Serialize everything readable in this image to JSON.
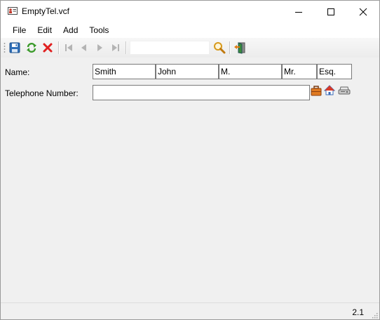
{
  "window": {
    "title": "EmptyTel.vcf",
    "icon": "vcard-icon"
  },
  "titlebar_buttons": {
    "minimize": "minimize-icon",
    "maximize": "maximize-icon",
    "close": "close-icon"
  },
  "menu": {
    "items": [
      {
        "label": "File"
      },
      {
        "label": "Edit"
      },
      {
        "label": "Add"
      },
      {
        "label": "Tools"
      }
    ]
  },
  "toolbar": {
    "buttons": [
      {
        "icon": "save-icon"
      },
      {
        "icon": "refresh-icon"
      },
      {
        "icon": "delete-icon"
      },
      {
        "icon": "first-record-icon"
      },
      {
        "icon": "previous-record-icon"
      },
      {
        "icon": "next-record-icon"
      },
      {
        "icon": "last-record-icon"
      },
      {
        "icon": "search-icon"
      },
      {
        "icon": "exit-icon"
      }
    ],
    "search_value": ""
  },
  "form": {
    "name_label": "Name:",
    "name_fields": [
      {
        "part": "family",
        "value": "Smith"
      },
      {
        "part": "given",
        "value": "John"
      },
      {
        "part": "middle",
        "value": "M."
      },
      {
        "part": "prefix",
        "value": "Mr."
      },
      {
        "part": "suffix",
        "value": "Esq."
      }
    ],
    "telephone_label": "Telephone Number:",
    "telephone_value": "",
    "telephone_type_icons": [
      "work-briefcase-icon",
      "home-house-icon",
      "fax-machine-icon"
    ]
  },
  "status": {
    "version": "2.1"
  },
  "colors": {
    "window_bg": "#f0f0f0",
    "titlebar_bg": "#ffffff",
    "field_border": "#7a7a7a",
    "save_blue": "#2f6fb8",
    "refresh_green": "#3a9a2a",
    "delete_red": "#e02020"
  }
}
